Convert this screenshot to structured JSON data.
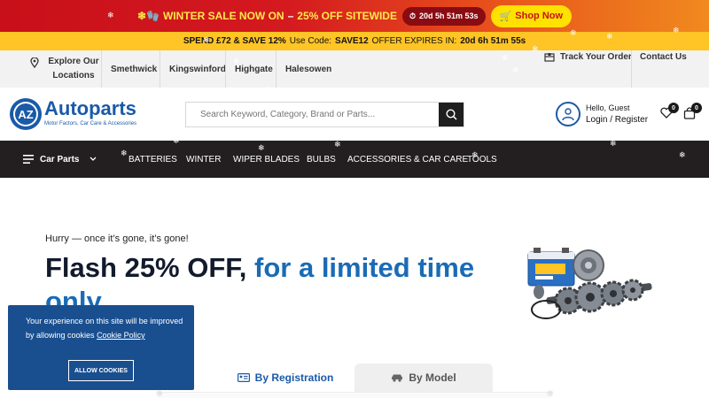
{
  "promo": {
    "emoji": "❄🧤",
    "sale": "WINTER SALE NOW ON",
    "dash": "–",
    "offer": "25% OFF SITEWIDE",
    "timer": "20d 5h 51m 53s",
    "shop_label": "Shop Now"
  },
  "spend": {
    "deal": "SPEND £72 & SAVE 12%",
    "use_code_label": "Use Code:",
    "code": "SAVE12",
    "expires_label": "OFFER EXPIRES IN:",
    "expires": "20d 6h 51m 55s"
  },
  "toplinks": {
    "locations": "Explore Our Locations",
    "stores": [
      "Smethwick",
      "Kingswinford",
      "Highgate",
      "Halesowen"
    ],
    "track": "Track Your Order",
    "contact": "Contact Us"
  },
  "header": {
    "logo_initials": "AZ",
    "logo_name": "Autoparts",
    "logo_tagline": "Motor Factors, Car Care & Accessories",
    "search_placeholder": "Search Keyword, Category, Brand or Parts...",
    "greeting": "Hello, Guest",
    "login": "Login / Register",
    "wishlist_count": "0",
    "cart_count": "0"
  },
  "nav": {
    "menu_label": "Car Parts",
    "items": [
      "BATTERIES",
      "WINTER",
      "WIPER BLADES",
      "BULBS",
      "ACCESSORIES & CAR CARE",
      "TOOLS"
    ]
  },
  "hero": {
    "kicker": "Hurry — once it’s gone, it’s gone!",
    "headline_dark": "Flash 25% OFF,",
    "headline_blue": "for a limited time only"
  },
  "tabs": {
    "registration": "By Registration",
    "model": "By Model"
  },
  "cookie": {
    "text": "Your experience on this site will be improved by allowing cookies",
    "link": "Cookie Policy",
    "button": "ALLOW COOKIES"
  },
  "colors": {
    "brand_blue": "#1a5aa8",
    "promo_red": "#c8101a",
    "promo_yellow": "#ffc425",
    "nav_dark": "#231f20"
  },
  "icons": {
    "location": "map-pin-icon",
    "track": "truck-icon",
    "search": "search-icon",
    "user": "user-icon",
    "wishlist": "heart-icon",
    "cart": "shopping-bag-icon",
    "menu": "hamburger-icon",
    "chevron": "chevron-down-icon"
  }
}
